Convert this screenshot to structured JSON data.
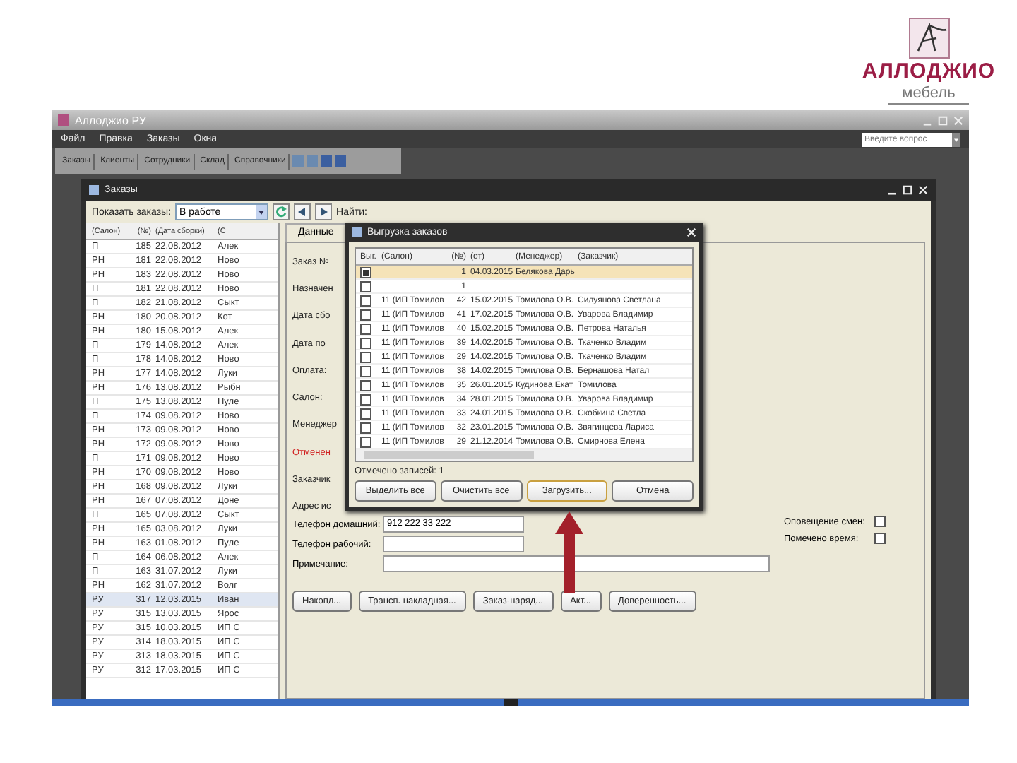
{
  "logo": {
    "name": "АЛЛОДЖИО",
    "tagline": "мебель"
  },
  "app": {
    "title": "Аллоджио РУ",
    "menu": [
      "Файл",
      "Правка",
      "Заказы",
      "Окна"
    ],
    "toolbar": [
      "Заказы",
      "Клиенты",
      "Сотрудники",
      "Склад",
      "Справочники"
    ],
    "help_placeholder": "Введите вопрос"
  },
  "orders_window": {
    "title": "Заказы",
    "filter_label": "Показать заказы:",
    "filter_value": "В работе",
    "search_label": "Найти:",
    "grid": {
      "columns": [
        "(Салон)",
        "(№)",
        "(Дата сборки)",
        "(С"
      ],
      "rows": [
        {
          "cells": [
            "П",
            "185",
            "22.08.2012",
            "Алек"
          ],
          "selected": false
        },
        {
          "cells": [
            "РН",
            "181",
            "22.08.2012",
            "Ново"
          ],
          "selected": false
        },
        {
          "cells": [
            "РН",
            "183",
            "22.08.2012",
            "Ново"
          ],
          "selected": false
        },
        {
          "cells": [
            "П",
            "181",
            "22.08.2012",
            "Ново"
          ],
          "selected": false
        },
        {
          "cells": [
            "П",
            "182",
            "21.08.2012",
            "Сыкт"
          ],
          "selected": false
        },
        {
          "cells": [
            "РН",
            "180",
            "20.08.2012",
            "Кот"
          ],
          "selected": false
        },
        {
          "cells": [
            "РН",
            "180",
            "15.08.2012",
            "Алек"
          ],
          "selected": false
        },
        {
          "cells": [
            "П",
            "179",
            "14.08.2012",
            "Алек"
          ],
          "selected": false
        },
        {
          "cells": [
            "П",
            "178",
            "14.08.2012",
            "Ново"
          ],
          "selected": false
        },
        {
          "cells": [
            "РН",
            "177",
            "14.08.2012",
            "Луки"
          ],
          "selected": false
        },
        {
          "cells": [
            "РН",
            "176",
            "13.08.2012",
            "Рыбн"
          ],
          "selected": false
        },
        {
          "cells": [
            "П",
            "175",
            "13.08.2012",
            "Пуле"
          ],
          "selected": false
        },
        {
          "cells": [
            "П",
            "174",
            "09.08.2012",
            "Ново"
          ],
          "selected": false
        },
        {
          "cells": [
            "РН",
            "173",
            "09.08.2012",
            "Ново"
          ],
          "selected": false
        },
        {
          "cells": [
            "РН",
            "172",
            "09.08.2012",
            "Ново"
          ],
          "selected": false
        },
        {
          "cells": [
            "П",
            "171",
            "09.08.2012",
            "Ново"
          ],
          "selected": false
        },
        {
          "cells": [
            "РН",
            "170",
            "09.08.2012",
            "Ново"
          ],
          "selected": false
        },
        {
          "cells": [
            "РН",
            "168",
            "09.08.2012",
            "Луки"
          ],
          "selected": false
        },
        {
          "cells": [
            "РН",
            "167",
            "07.08.2012",
            "Доне"
          ],
          "selected": false
        },
        {
          "cells": [
            "П",
            "165",
            "07.08.2012",
            "Сыкт"
          ],
          "selected": false
        },
        {
          "cells": [
            "РН",
            "165",
            "03.08.2012",
            "Луки"
          ],
          "selected": false
        },
        {
          "cells": [
            "РН",
            "163",
            "01.08.2012",
            "Пуле"
          ],
          "selected": false
        },
        {
          "cells": [
            "П",
            "164",
            "06.08.2012",
            "Алек"
          ],
          "selected": false
        },
        {
          "cells": [
            "П",
            "163",
            "31.07.2012",
            "Луки"
          ],
          "selected": false
        },
        {
          "cells": [
            "РН",
            "162",
            "31.07.2012",
            "Волг"
          ],
          "selected": false
        },
        {
          "cells": [
            "РУ",
            "317",
            "12.03.2015",
            "Иван"
          ],
          "selected": true
        },
        {
          "cells": [
            "РУ",
            "315",
            "13.03.2015",
            "Ярос"
          ],
          "selected": false
        },
        {
          "cells": [
            "РУ",
            "315",
            "10.03.2015",
            "ИП С"
          ],
          "selected": false
        },
        {
          "cells": [
            "РУ",
            "314",
            "18.03.2015",
            "ИП С"
          ],
          "selected": false
        },
        {
          "cells": [
            "РУ",
            "313",
            "18.03.2015",
            "ИП С"
          ],
          "selected": false
        },
        {
          "cells": [
            "РУ",
            "312",
            "17.03.2015",
            "ИП С"
          ],
          "selected": false
        }
      ]
    },
    "tabs": [
      {
        "label": "Данные",
        "selected": true
      }
    ],
    "form_labels": [
      {
        "text": "Заказ №",
        "kind": "normal"
      },
      {
        "text": "Назначен",
        "kind": "normal"
      },
      {
        "text": "Дата сбо",
        "kind": "normal"
      },
      {
        "text": "Дата по",
        "kind": "normal"
      },
      {
        "text": "Оплата:",
        "kind": "normal"
      },
      {
        "text": "Салон:",
        "kind": "normal"
      },
      {
        "text": "Менеджер",
        "kind": "normal"
      },
      {
        "text": "Отменен",
        "kind": "warning"
      },
      {
        "text": "Заказчик",
        "kind": "normal"
      },
      {
        "text": "Адрес ис",
        "kind": "normal"
      }
    ],
    "fields": [
      {
        "label": "Телефон домашний:",
        "value": "912 222 33 222"
      },
      {
        "label": "Телефон рабочий:"
      },
      {
        "label": "Примечание:"
      }
    ],
    "flags": [
      {
        "label": "Оповещение смен:",
        "checked": false
      },
      {
        "label": "Помечено время:",
        "checked": false
      }
    ],
    "buttons": [
      "Накопл...",
      "Трансп. накладная...",
      "Заказ-наряд...",
      "Акт...",
      "Доверенность..."
    ]
  },
  "export_dialog": {
    "title": "Выгрузка заказов",
    "check_header": "Выг.",
    "columns": [
      "(Салон)",
      "(№)",
      "(от)",
      "(Менеджер)",
      "(Заказчик)"
    ],
    "rows": [
      {
        "checked": true,
        "selected": true,
        "cells": [
          "",
          "1",
          "04.03.2015",
          "Белякова Дарь",
          ""
        ]
      },
      {
        "checked": false,
        "selected": false,
        "cells": [
          "",
          "1",
          "",
          "",
          ""
        ]
      },
      {
        "checked": false,
        "selected": false,
        "cells": [
          "11 (ИП Томилов",
          "42",
          "15.02.2015",
          "Томилова О.В.",
          "Силуянова Светлана"
        ]
      },
      {
        "checked": false,
        "selected": false,
        "cells": [
          "11 (ИП Томилов",
          "41",
          "17.02.2015",
          "Томилова О.В.",
          "Уварова Владимир"
        ]
      },
      {
        "checked": false,
        "selected": false,
        "cells": [
          "11 (ИП Томилов",
          "40",
          "15.02.2015",
          "Томилова О.В.",
          "Петрова Наталья"
        ]
      },
      {
        "checked": false,
        "selected": false,
        "cells": [
          "11 (ИП Томилов",
          "39",
          "14.02.2015",
          "Томилова О.В.",
          "Ткаченко Владим"
        ]
      },
      {
        "checked": false,
        "selected": false,
        "cells": [
          "11 (ИП Томилов",
          "29",
          "14.02.2015",
          "Томилова О.В.",
          "Ткаченко Владим"
        ]
      },
      {
        "checked": false,
        "selected": false,
        "cells": [
          "11 (ИП Томилов",
          "38",
          "14.02.2015",
          "Томилова О.В.",
          "Бернашова Натал"
        ]
      },
      {
        "checked": false,
        "selected": false,
        "cells": [
          "11 (ИП Томилов",
          "35",
          "26.01.2015",
          "Кудинова Екат",
          "Томилова"
        ]
      },
      {
        "checked": false,
        "selected": false,
        "cells": [
          "11 (ИП Томилов",
          "34",
          "28.01.2015",
          "Томилова О.В.",
          "Уварова Владимир"
        ]
      },
      {
        "checked": false,
        "selected": false,
        "cells": [
          "11 (ИП Томилов",
          "33",
          "24.01.2015",
          "Томилова О.В.",
          "Скобкина Светла"
        ]
      },
      {
        "checked": false,
        "selected": false,
        "cells": [
          "11 (ИП Томилов",
          "32",
          "23.01.2015",
          "Томилова О.В.",
          "Звягинцева Лариса"
        ]
      },
      {
        "checked": false,
        "selected": false,
        "cells": [
          "11 (ИП Томилов",
          "29",
          "21.12.2014",
          "Томилова О.В.",
          "Смирнова Елена"
        ]
      }
    ],
    "status": "Отмечено записей: 1",
    "buttons": [
      {
        "label": "Выделить все",
        "default": false
      },
      {
        "label": "Очистить все",
        "default": false
      },
      {
        "label": "Загрузить...",
        "default": true
      },
      {
        "label": "Отмена",
        "default": false
      }
    ]
  }
}
